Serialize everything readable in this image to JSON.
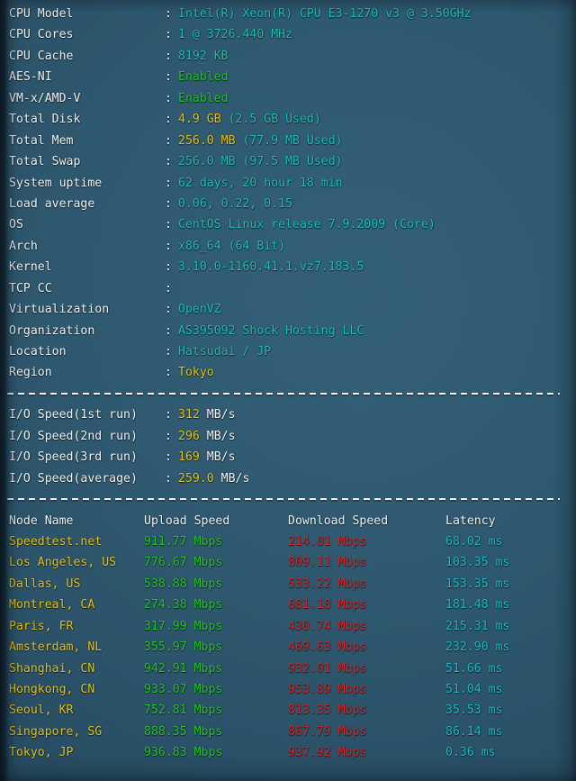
{
  "theme": {
    "background": "#2e586f",
    "label_color": "#f2f4f5",
    "cyan": "#1bbfb4",
    "green": "#22c522",
    "yellow": "#e8c209",
    "red": "#e12120",
    "latency_cyan": "#1cb9c4"
  },
  "system_info": {
    "separator_label": "dashed-separator",
    "rows": [
      {
        "label": "CPU Model",
        "colon": ":",
        "value": "Intel(R) Xeon(R) CPU E3-1270 v3 @ 3.50GHz",
        "value_color": "cyan"
      },
      {
        "label": "CPU Cores",
        "colon": ":",
        "value": "1 @ 3726.440 MHz",
        "value_color": "cyan"
      },
      {
        "label": "CPU Cache",
        "colon": ":",
        "value": "8192 KB",
        "value_color": "cyan"
      },
      {
        "label": "AES-NI",
        "colon": ":",
        "value": "Enabled",
        "value_color": "green"
      },
      {
        "label": "VM-x/AMD-V",
        "colon": ":",
        "value": "Enabled",
        "value_color": "green"
      },
      {
        "label": "Total Disk",
        "colon": ":",
        "value": "4.9 GB",
        "value_color": "yellow",
        "suffix": "(2.5 GB Used)",
        "suffix_color": "cyan"
      },
      {
        "label": "Total Mem",
        "colon": ":",
        "value": "256.0 MB",
        "value_color": "yellow",
        "suffix": "(77.9 MB Used)",
        "suffix_color": "cyan"
      },
      {
        "label": "Total Swap",
        "colon": ":",
        "value": "256.0 MB",
        "value_color": "cyan",
        "suffix": "(97.5 MB Used)",
        "suffix_color": "cyan"
      },
      {
        "label": "System uptime",
        "colon": ":",
        "value": "62 days, 20 hour 18 min",
        "value_color": "cyan"
      },
      {
        "label": "Load average",
        "colon": ":",
        "value": "0.06, 0.22, 0.15",
        "value_color": "cyan"
      },
      {
        "label": "OS",
        "colon": ":",
        "value": "CentOS Linux release 7.9.2009 (Core)",
        "value_color": "cyan"
      },
      {
        "label": "Arch",
        "colon": ":",
        "value": "x86_64 (64 Bit)",
        "value_color": "cyan"
      },
      {
        "label": "Kernel",
        "colon": ":",
        "value": "3.10.0-1160.41.1.vz7.183.5",
        "value_color": "cyan"
      },
      {
        "label": "TCP CC",
        "colon": ":",
        "value": "",
        "value_color": "cyan"
      },
      {
        "label": "Virtualization",
        "colon": ":",
        "value": "OpenVZ",
        "value_color": "cyan"
      },
      {
        "label": "Organization",
        "colon": ":",
        "value": "AS395092 Shock Hosting LLC",
        "value_color": "cyan"
      },
      {
        "label": "Location",
        "colon": ":",
        "value": "Hatsudai / JP",
        "value_color": "cyan"
      },
      {
        "label": "Region",
        "colon": ":",
        "value": "Tokyo",
        "value_color": "yellow"
      }
    ]
  },
  "io_speed": {
    "rows": [
      {
        "label": "I/O Speed(1st run)",
        "colon": ":",
        "value": "312",
        "unit": "MB/s"
      },
      {
        "label": "I/O Speed(2nd run)",
        "colon": ":",
        "value": "296",
        "unit": "MB/s"
      },
      {
        "label": "I/O Speed(3rd run)",
        "colon": ":",
        "value": "169",
        "unit": "MB/s"
      },
      {
        "label": "I/O Speed(average)",
        "colon": ":",
        "value": "259.0",
        "unit": "MB/s"
      }
    ]
  },
  "network_test": {
    "headers": {
      "node": "Node Name",
      "upload": "Upload Speed",
      "download": "Download Speed",
      "latency": "Latency"
    },
    "unit_speed": "Mbps",
    "unit_latency": "ms",
    "rows": [
      {
        "node": "Speedtest.net",
        "upload": "911.77",
        "download": "214.01",
        "latency": "68.02"
      },
      {
        "node": "Los Angeles, US",
        "upload": "776.67",
        "download": "809.11",
        "latency": "103.35"
      },
      {
        "node": "Dallas, US",
        "upload": "538.88",
        "download": "533.22",
        "latency": "153.35"
      },
      {
        "node": "Montreal, CA",
        "upload": "274.38",
        "download": "681.18",
        "latency": "181.48"
      },
      {
        "node": "Paris, FR",
        "upload": "317.99",
        "download": "430.74",
        "latency": "215.31"
      },
      {
        "node": "Amsterdam, NL",
        "upload": "355.97",
        "download": "469.63",
        "latency": "232.90"
      },
      {
        "node": "Shanghai, CN",
        "upload": "942.91",
        "download": "932.01",
        "latency": "51.66"
      },
      {
        "node": "Hongkong, CN",
        "upload": "933.07",
        "download": "953.89",
        "latency": "51.04"
      },
      {
        "node": "Seoul, KR",
        "upload": "752.81",
        "download": "813.35",
        "latency": "35.53"
      },
      {
        "node": "Singapore, SG",
        "upload": "888.35",
        "download": "867.79",
        "latency": "86.14"
      },
      {
        "node": "Tokyo, JP",
        "upload": "936.83",
        "download": "937.92",
        "latency": "0.36"
      }
    ]
  }
}
